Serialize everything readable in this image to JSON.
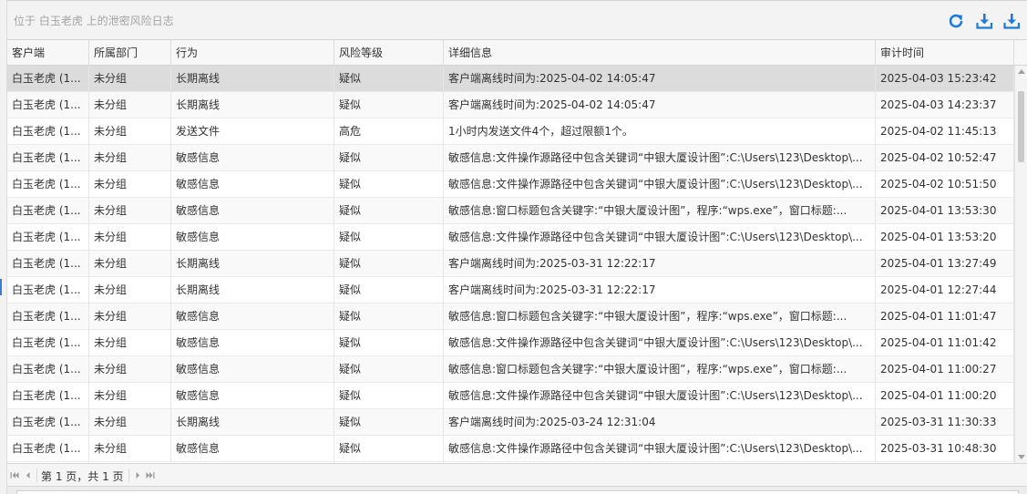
{
  "panel": {
    "title": "位于 白玉老虎 上的泄密风险日志"
  },
  "toolbar": {
    "refresh_icon": "refresh-icon",
    "export_icon": "download-icon",
    "accent_color": "#1e7cd6"
  },
  "table": {
    "columns": [
      "客户端",
      "所属部门",
      "行为",
      "风险等级",
      "详细信息",
      "审计时间"
    ],
    "rows": [
      [
        "白玉老虎 (1...",
        "未分组",
        "长期离线",
        "疑似",
        "客户端离线时间为:2025-04-02 14:05:47",
        "2025-04-03 15:23:42"
      ],
      [
        "白玉老虎 (1...",
        "未分组",
        "长期离线",
        "疑似",
        "客户端离线时间为:2025-04-02 14:05:47",
        "2025-04-03 14:23:37"
      ],
      [
        "白玉老虎 (1...",
        "未分组",
        "发送文件",
        "高危",
        "1小时内发送文件4个，超过限额1个。",
        "2025-04-02 11:45:13"
      ],
      [
        "白玉老虎 (1...",
        "未分组",
        "敏感信息",
        "疑似",
        "敏感信息:文件操作源路径中包含关键词“中银大厦设计图”:C:\\Users\\123\\Desktop\\...",
        "2025-04-02 10:52:47"
      ],
      [
        "白玉老虎 (1...",
        "未分组",
        "敏感信息",
        "疑似",
        "敏感信息:文件操作源路径中包含关键词“中银大厦设计图”:C:\\Users\\123\\Desktop\\...",
        "2025-04-02 10:51:50"
      ],
      [
        "白玉老虎 (1...",
        "未分组",
        "敏感信息",
        "疑似",
        "敏感信息:窗口标题包含关键字:“中银大厦设计图”，程序:“wps.exe”，窗口标题:...",
        "2025-04-01 13:53:30"
      ],
      [
        "白玉老虎 (1...",
        "未分组",
        "敏感信息",
        "疑似",
        "敏感信息:文件操作源路径中包含关键词“中银大厦设计图”:C:\\Users\\123\\Desktop\\...",
        "2025-04-01 13:53:20"
      ],
      [
        "白玉老虎 (1...",
        "未分组",
        "长期离线",
        "疑似",
        "客户端离线时间为:2025-03-31 12:22:17",
        "2025-04-01 13:27:49"
      ],
      [
        "白玉老虎 (1...",
        "未分组",
        "长期离线",
        "疑似",
        "客户端离线时间为:2025-03-31 12:22:17",
        "2025-04-01 12:27:44"
      ],
      [
        "白玉老虎 (1...",
        "未分组",
        "敏感信息",
        "疑似",
        "敏感信息:窗口标题包含关键字:“中银大厦设计图”，程序:“wps.exe”，窗口标题:...",
        "2025-04-01 11:01:47"
      ],
      [
        "白玉老虎 (1...",
        "未分组",
        "敏感信息",
        "疑似",
        "敏感信息:文件操作源路径中包含关键词“中银大厦设计图”:C:\\Users\\123\\Desktop\\...",
        "2025-04-01 11:01:42"
      ],
      [
        "白玉老虎 (1...",
        "未分组",
        "敏感信息",
        "疑似",
        "敏感信息:窗口标题包含关键字:“中银大厦设计图”，程序:“wps.exe”，窗口标题:...",
        "2025-04-01 11:00:27"
      ],
      [
        "白玉老虎 (1...",
        "未分组",
        "敏感信息",
        "疑似",
        "敏感信息:文件操作源路径中包含关键词“中银大厦设计图”:C:\\Users\\123\\Desktop\\...",
        "2025-04-01 11:00:20"
      ],
      [
        "白玉老虎 (1...",
        "未分组",
        "长期离线",
        "疑似",
        "客户端离线时间为:2025-03-24 12:31:04",
        "2025-03-31 11:30:33"
      ],
      [
        "白玉老虎 (1...",
        "未分组",
        "敏感信息",
        "疑似",
        "敏感信息:文件操作源路径中包含关键词“中银大厦设计图”:C:\\Users\\123\\Desktop\\...",
        "2025-03-31 10:48:30"
      ]
    ],
    "selected_row": 0
  },
  "pager": {
    "page_info": "第 1 页，共 1 页"
  }
}
